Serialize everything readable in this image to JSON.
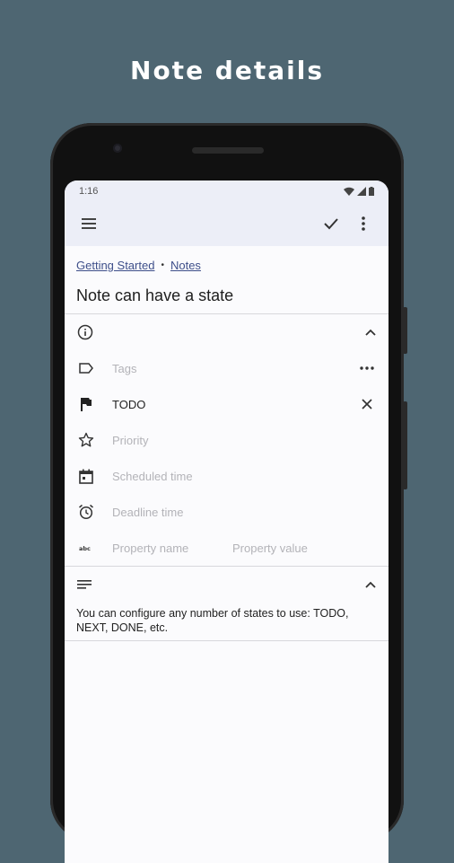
{
  "caption": "Note details",
  "status_bar": {
    "time": "1:16"
  },
  "breadcrumb": {
    "book": "Getting Started",
    "separator": "•",
    "note": "Notes"
  },
  "note": {
    "title": "Note can have a state"
  },
  "properties": {
    "tags_placeholder": "Tags",
    "state_value": "TODO",
    "priority_placeholder": "Priority",
    "scheduled_placeholder": "Scheduled time",
    "deadline_placeholder": "Deadline time",
    "property_name_placeholder": "Property name",
    "property_value_placeholder": "Property value"
  },
  "content": {
    "text": "You can configure any number of states to use: TODO, NEXT, DONE, etc."
  },
  "colors": {
    "background": "#4e6672",
    "toolbar": "#eceef7",
    "link": "#3e4f8a"
  }
}
